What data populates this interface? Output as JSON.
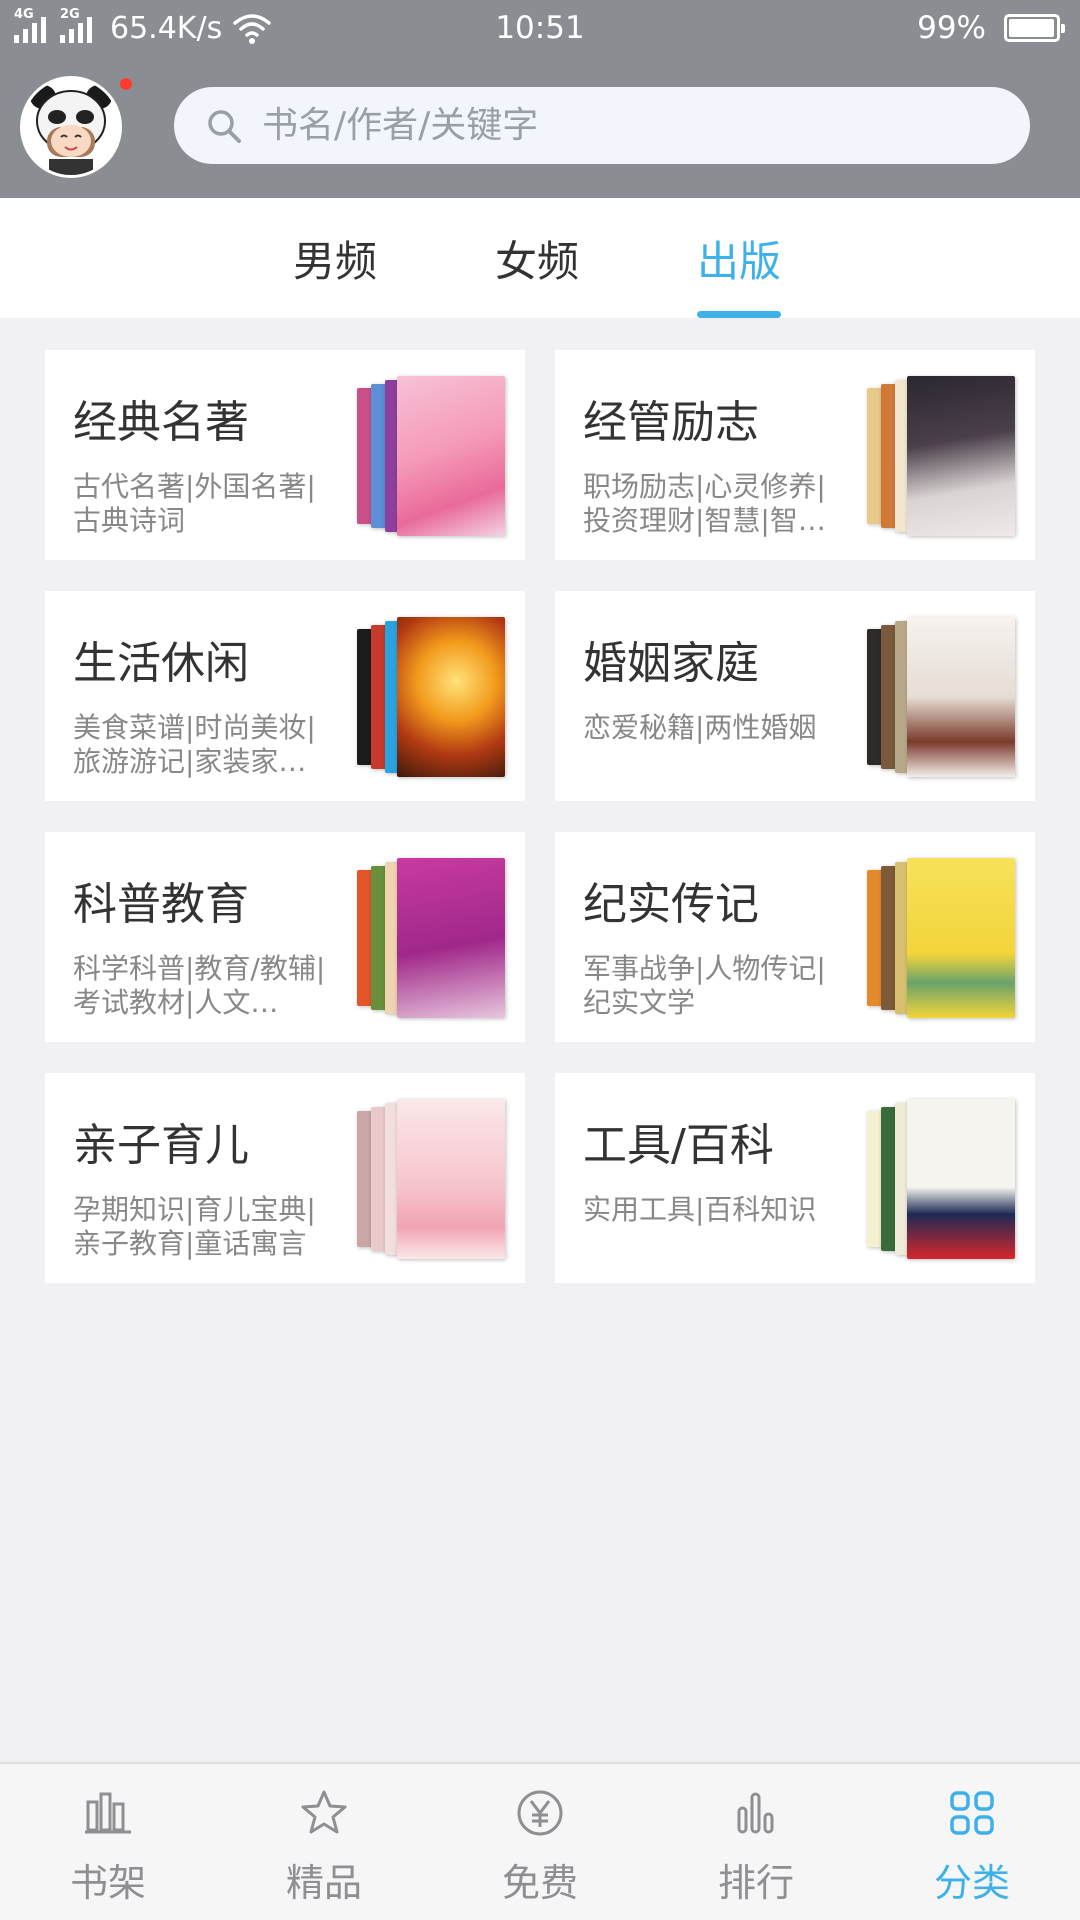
{
  "status_bar": {
    "network_1": "4G",
    "network_2": "2G",
    "speed": "65.4K/s",
    "time": "10:51",
    "battery": "99%"
  },
  "search": {
    "placeholder": "书名/作者/关键字"
  },
  "tabs": [
    {
      "label": "男频"
    },
    {
      "label": "女频"
    },
    {
      "label": "出版",
      "active": true
    }
  ],
  "categories": [
    {
      "title": "经典名著",
      "desc": "古代名著|外国名著|古典诗词"
    },
    {
      "title": "经管励志",
      "desc": "职场励志|心灵修养|投资理财|智慧|智…"
    },
    {
      "title": "生活休闲",
      "desc": "美食菜谱|时尚美妆|旅游游记|家装家…"
    },
    {
      "title": "婚姻家庭",
      "desc": "恋爱秘籍|两性婚姻"
    },
    {
      "title": "科普教育",
      "desc": "科学科普|教育/教辅|考试教材|人文…"
    },
    {
      "title": "纪实传记",
      "desc": "军事战争|人物传记|纪实文学"
    },
    {
      "title": "亲子育儿",
      "desc": "孕期知识|育儿宝典|亲子教育|童话寓言"
    },
    {
      "title": "工具/百科",
      "desc": "实用工具|百科知识"
    }
  ],
  "bottom_nav": [
    {
      "label": "书架",
      "icon": "bookshelf-icon"
    },
    {
      "label": "精品",
      "icon": "star-icon"
    },
    {
      "label": "免费",
      "icon": "yen-icon"
    },
    {
      "label": "排行",
      "icon": "ranking-icon"
    },
    {
      "label": "分类",
      "icon": "category-grid-icon",
      "active": true
    }
  ],
  "colors": {
    "header": "#8a8e93",
    "accent": "#3fb1ea",
    "background": "#f1f1f3"
  }
}
